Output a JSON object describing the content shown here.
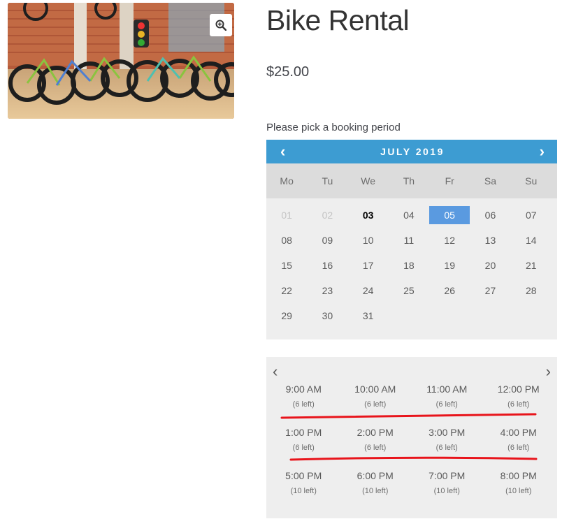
{
  "product": {
    "title": "Bike Rental",
    "price": "$25.00",
    "image_alt": "Bicycles lined up in a shop",
    "zoom_icon": "zoom-in-icon"
  },
  "booking": {
    "prompt": "Please pick a booking period"
  },
  "calendar": {
    "month_label": "JULY 2019",
    "prev_icon": "‹",
    "next_icon": "›",
    "weekdays": [
      "Mo",
      "Tu",
      "We",
      "Th",
      "Fr",
      "Sa",
      "Su"
    ],
    "days": [
      {
        "label": "01",
        "state": "past"
      },
      {
        "label": "02",
        "state": "past"
      },
      {
        "label": "03",
        "state": "today"
      },
      {
        "label": "04",
        "state": ""
      },
      {
        "label": "05",
        "state": "selected"
      },
      {
        "label": "06",
        "state": ""
      },
      {
        "label": "07",
        "state": ""
      },
      {
        "label": "08",
        "state": ""
      },
      {
        "label": "09",
        "state": ""
      },
      {
        "label": "10",
        "state": ""
      },
      {
        "label": "11",
        "state": ""
      },
      {
        "label": "12",
        "state": ""
      },
      {
        "label": "13",
        "state": ""
      },
      {
        "label": "14",
        "state": ""
      },
      {
        "label": "15",
        "state": ""
      },
      {
        "label": "16",
        "state": ""
      },
      {
        "label": "17",
        "state": ""
      },
      {
        "label": "18",
        "state": ""
      },
      {
        "label": "19",
        "state": ""
      },
      {
        "label": "20",
        "state": ""
      },
      {
        "label": "21",
        "state": ""
      },
      {
        "label": "22",
        "state": ""
      },
      {
        "label": "23",
        "state": ""
      },
      {
        "label": "24",
        "state": ""
      },
      {
        "label": "25",
        "state": ""
      },
      {
        "label": "26",
        "state": ""
      },
      {
        "label": "27",
        "state": ""
      },
      {
        "label": "28",
        "state": ""
      },
      {
        "label": "29",
        "state": ""
      },
      {
        "label": "30",
        "state": ""
      },
      {
        "label": "31",
        "state": ""
      }
    ],
    "colors": {
      "header": "#3d9cd2",
      "selected": "#5a9ae0",
      "body": "#eeeeee",
      "weekday_bar": "#dcdcdc"
    }
  },
  "time_slots": {
    "prev_icon": "‹",
    "next_icon": "›",
    "rows": [
      [
        {
          "time": "9:00 AM",
          "left": "(6 left)"
        },
        {
          "time": "10:00 AM",
          "left": "(6 left)"
        },
        {
          "time": "11:00 AM",
          "left": "(6 left)"
        },
        {
          "time": "12:00 PM",
          "left": "(6 left)"
        }
      ],
      [
        {
          "time": "1:00 PM",
          "left": "(6 left)"
        },
        {
          "time": "2:00 PM",
          "left": "(6 left)"
        },
        {
          "time": "3:00 PM",
          "left": "(6 left)"
        },
        {
          "time": "4:00 PM",
          "left": "(6 left)"
        }
      ],
      [
        {
          "time": "5:00 PM",
          "left": "(10 left)"
        },
        {
          "time": "6:00 PM",
          "left": "(10 left)"
        },
        {
          "time": "7:00 PM",
          "left": "(10 left)"
        },
        {
          "time": "8:00 PM",
          "left": "(10 left)"
        }
      ]
    ],
    "annotation_color": "#e8141b"
  }
}
